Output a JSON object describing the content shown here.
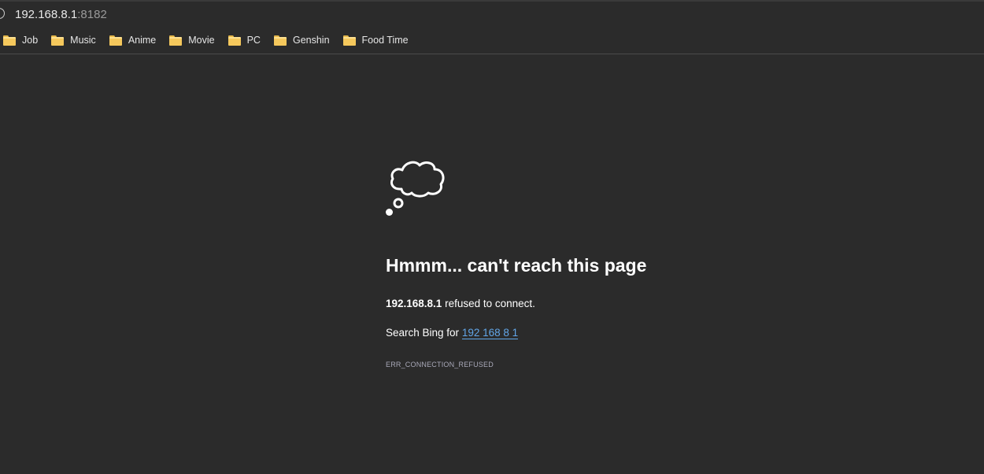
{
  "addressbar": {
    "host": "192.168.8.1",
    "port": ":8182"
  },
  "bookmarks": [
    {
      "label": "Job",
      "icon": "folder-icon"
    },
    {
      "label": "Music",
      "icon": "folder-icon"
    },
    {
      "label": "Anime",
      "icon": "folder-icon"
    },
    {
      "label": "Movie",
      "icon": "folder-icon"
    },
    {
      "label": "PC",
      "icon": "folder-icon"
    },
    {
      "label": "Genshin",
      "icon": "folder-icon"
    },
    {
      "label": "Food Time",
      "icon": "folder-icon"
    }
  ],
  "error": {
    "icon": "thought-cloud-icon",
    "headline": "Hmmm... can't reach this page",
    "host": "192.168.8.1",
    "message": " refused to connect.",
    "search_prefix": "Search Bing for ",
    "search_link": "192 168 8 1",
    "code": "ERR_CONNECTION_REFUSED"
  },
  "colors": {
    "background": "#2b2b2b",
    "link": "#62a6e8",
    "folder": "#f5c85c"
  }
}
